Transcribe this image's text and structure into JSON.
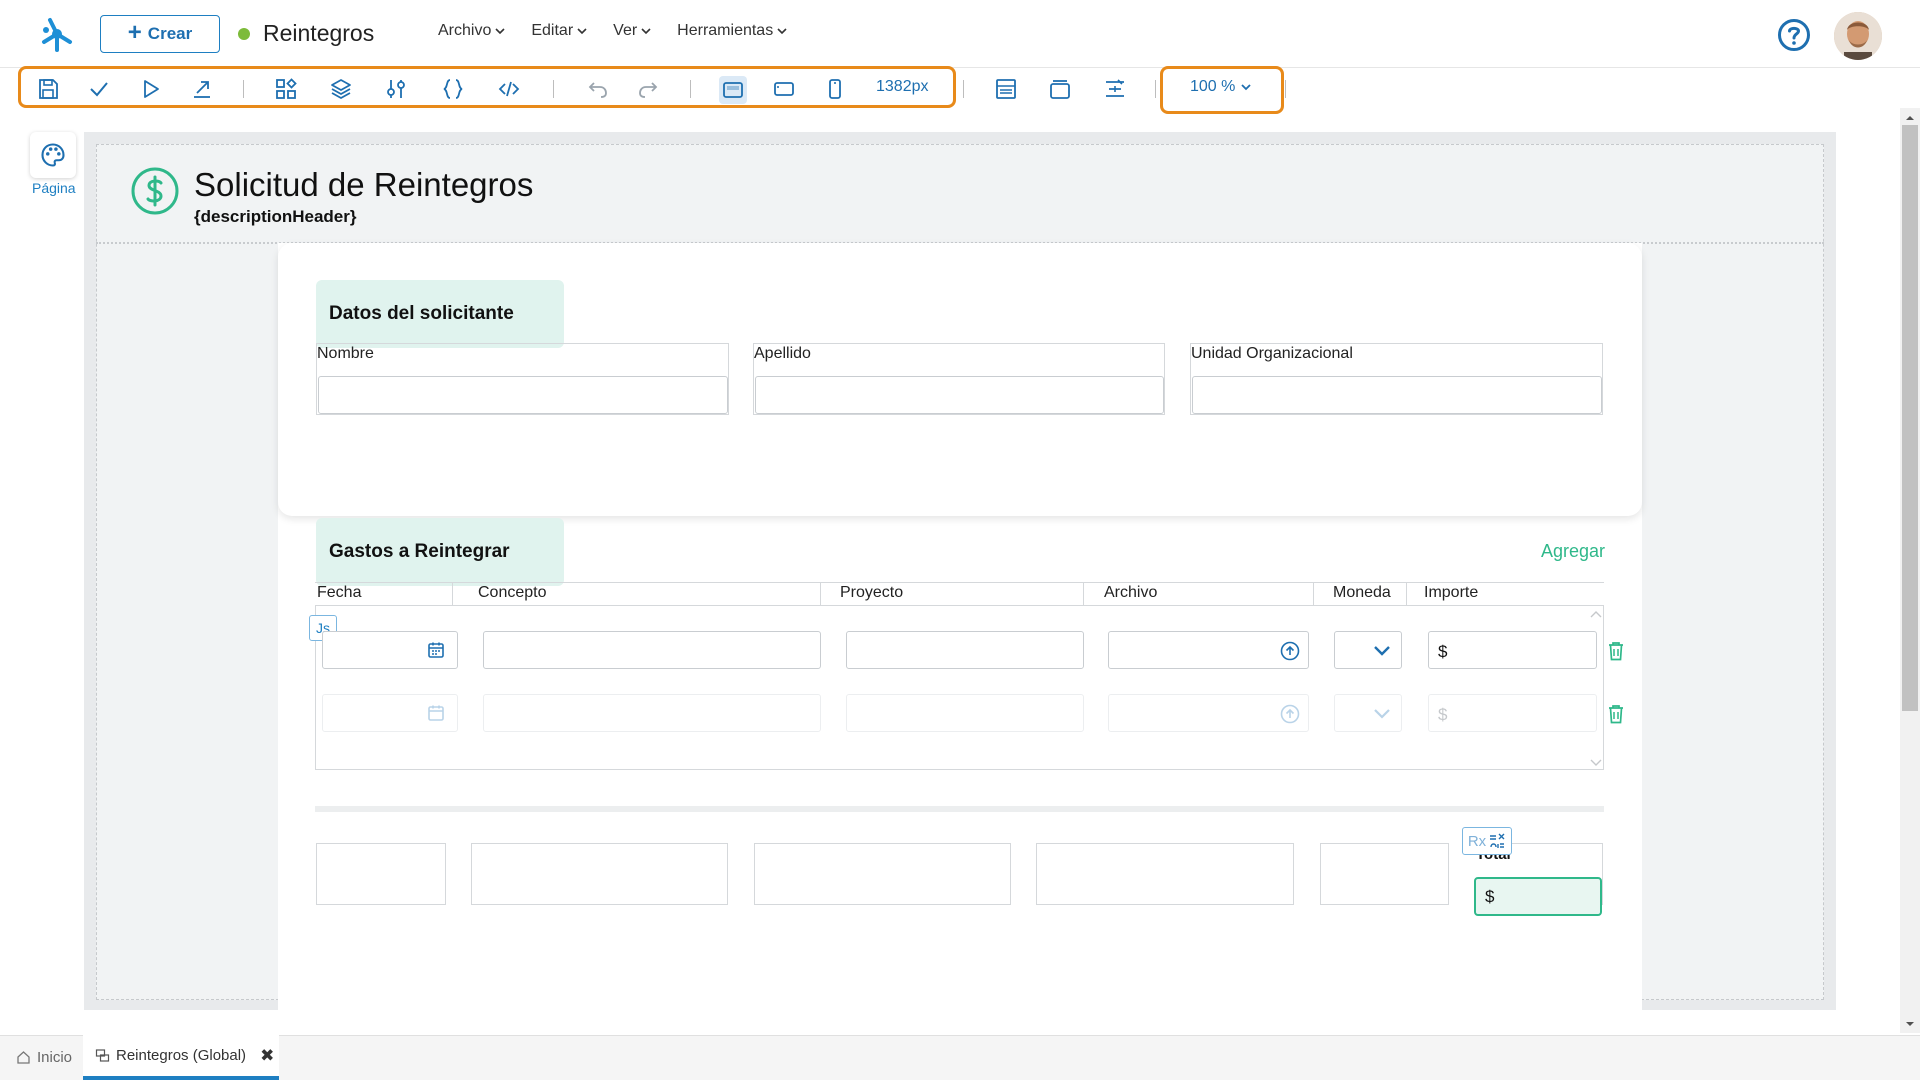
{
  "header": {
    "crear_label": "Crear",
    "app_title": "Reintegros",
    "menu": [
      {
        "label": "Archivo"
      },
      {
        "label": "Editar"
      },
      {
        "label": "Ver"
      },
      {
        "label": "Herramientas"
      }
    ]
  },
  "toolbar": {
    "width_label": "1382px",
    "zoom_label": "100 %"
  },
  "sidebar": {
    "page_label": "Página"
  },
  "form": {
    "title": "Solicitud de Reintegros",
    "description": "{descriptionHeader}",
    "section1": {
      "title": "Datos del solicitante",
      "fields": [
        {
          "label": "Nombre"
        },
        {
          "label": "Apellido"
        },
        {
          "label": "Unidad Organizacional"
        }
      ]
    },
    "section2": {
      "title": "Gastos a Reintegrar",
      "add_label": "Agregar",
      "columns": [
        "Fecha",
        "Concepto",
        "Proyecto",
        "Archivo",
        "Moneda",
        "Importe"
      ],
      "currency_symbol": "$",
      "js_badge": "Js"
    },
    "totals": {
      "rx_badge": "Rx",
      "total_label": "Total",
      "currency_symbol": "$"
    }
  },
  "bottom_tabs": [
    {
      "label": "Inicio"
    },
    {
      "label": "Reintegros (Global)"
    }
  ],
  "colors": {
    "primary": "#1e7fc2",
    "accent_green": "#2fb88a",
    "highlight_orange": "#e88a1a",
    "status_dot": "#7dbb3a"
  }
}
